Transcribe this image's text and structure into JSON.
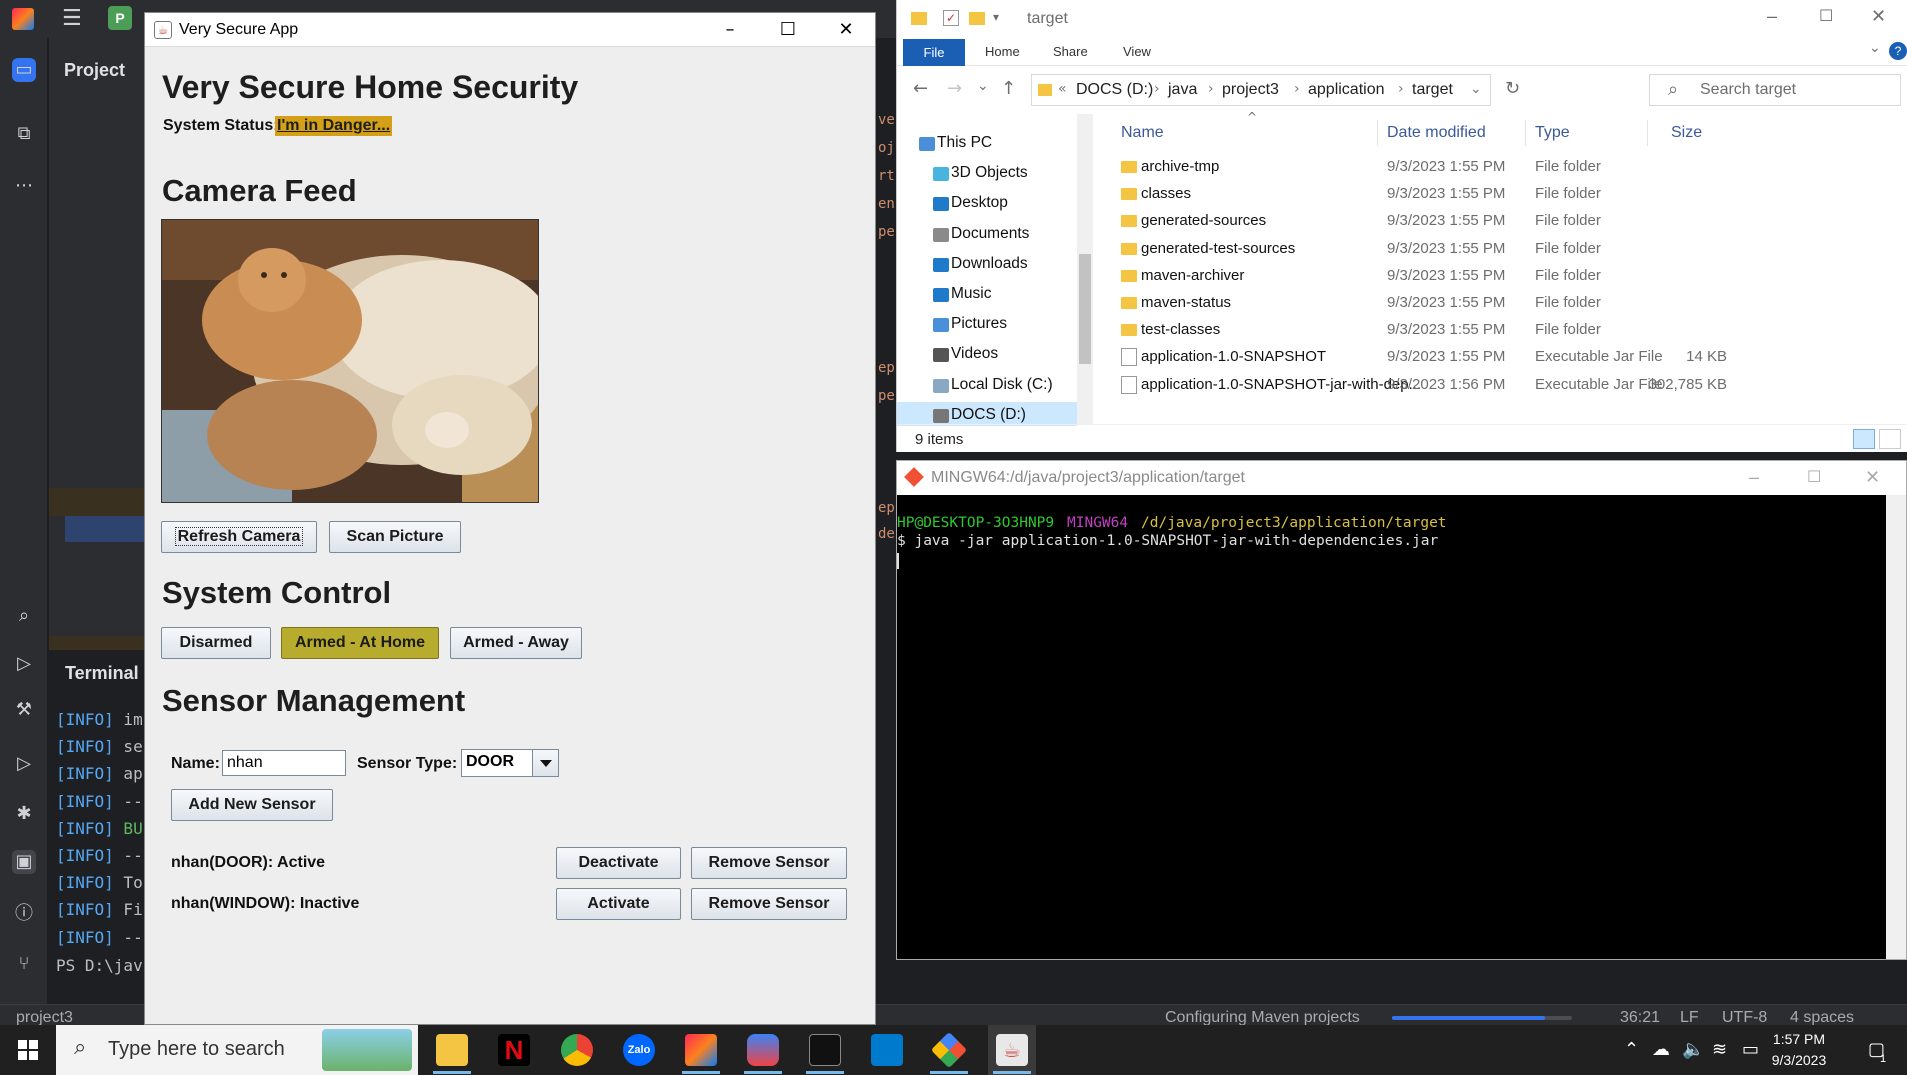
{
  "ide": {
    "project_label": "Project",
    "terminal_label": "Terminal",
    "terminal_lines": [
      {
        "tag": "[INFO]",
        "text": " im"
      },
      {
        "tag": "[INFO]",
        "text": " se"
      },
      {
        "tag": "[INFO]",
        "text": " ap"
      },
      {
        "tag": "[INFO]",
        "text": " --"
      },
      {
        "tag": "[INFO]",
        "text": " BU"
      },
      {
        "tag": "[INFO]",
        "text": " --"
      },
      {
        "tag": "[INFO]",
        "text": " To"
      },
      {
        "tag": "[INFO]",
        "text": " Fi"
      },
      {
        "tag": "[INFO]",
        "text": " --"
      }
    ],
    "prompt": "PS D:\\jav",
    "statusbar": {
      "project": "project3",
      "task": "Configuring Maven projects",
      "task_progress": 0.85,
      "position": "36:21",
      "line_sep": "LF",
      "encoding": "UTF-8",
      "indent": "4 spaces"
    }
  },
  "swing": {
    "title": "Very Secure App",
    "heading": "Very Secure Home Security",
    "status_label": "System Status:",
    "status_value": "I'm in Danger...",
    "camera_heading": "Camera Feed",
    "refresh_btn": "Refresh Camera",
    "scan_btn": "Scan Picture",
    "control_heading": "System Control",
    "mode_buttons": [
      "Disarmed",
      "Armed - At Home",
      "Armed - Away"
    ],
    "active_mode": "Armed - At Home",
    "sensor_heading": "Sensor Management",
    "name_label": "Name:",
    "name_value": "nhan",
    "type_label": "Sensor Type:",
    "type_value": "DOOR",
    "add_btn": "Add New Sensor",
    "sensors": [
      {
        "label": "nhan(DOOR): Active",
        "toggle": "Deactivate",
        "remove": "Remove Sensor"
      },
      {
        "label": "nhan(WINDOW): Inactive",
        "toggle": "Activate",
        "remove": "Remove Sensor"
      }
    ]
  },
  "explorer": {
    "title": "target",
    "tabs": [
      "File",
      "Home",
      "Share",
      "View"
    ],
    "breadcrumb": [
      "DOCS (D:)",
      "java",
      "project3",
      "application",
      "target"
    ],
    "search_placeholder": "Search target",
    "nav": [
      "This PC",
      "3D Objects",
      "Desktop",
      "Documents",
      "Downloads",
      "Music",
      "Pictures",
      "Videos",
      "Local Disk (C:)",
      "DOCS (D:)"
    ],
    "columns": [
      "Name",
      "Date modified",
      "Type",
      "Size"
    ],
    "files": [
      {
        "name": "archive-tmp",
        "date": "9/3/2023 1:55 PM",
        "type": "File folder",
        "size": "",
        "kind": "folder"
      },
      {
        "name": "classes",
        "date": "9/3/2023 1:55 PM",
        "type": "File folder",
        "size": "",
        "kind": "folder"
      },
      {
        "name": "generated-sources",
        "date": "9/3/2023 1:55 PM",
        "type": "File folder",
        "size": "",
        "kind": "folder"
      },
      {
        "name": "generated-test-sources",
        "date": "9/3/2023 1:55 PM",
        "type": "File folder",
        "size": "",
        "kind": "folder"
      },
      {
        "name": "maven-archiver",
        "date": "9/3/2023 1:55 PM",
        "type": "File folder",
        "size": "",
        "kind": "folder"
      },
      {
        "name": "maven-status",
        "date": "9/3/2023 1:55 PM",
        "type": "File folder",
        "size": "",
        "kind": "folder"
      },
      {
        "name": "test-classes",
        "date": "9/3/2023 1:55 PM",
        "type": "File folder",
        "size": "",
        "kind": "folder"
      },
      {
        "name": "application-1.0-SNAPSHOT",
        "date": "9/3/2023 1:55 PM",
        "type": "Executable Jar File",
        "size": "14 KB",
        "kind": "jar"
      },
      {
        "name": "application-1.0-SNAPSHOT-jar-with-dep...",
        "date": "9/3/2023 1:56 PM",
        "type": "Executable Jar File",
        "size": "302,785 KB",
        "kind": "jar"
      }
    ],
    "item_count": "9 items"
  },
  "mingw": {
    "title": "MINGW64:/d/java/project3/application/target",
    "user_host": "HP@DESKTOP-3O3HNP9",
    "shell": "MINGW64",
    "path": "/d/java/project3/application/target",
    "command": "$ java -jar application-1.0-SNAPSHOT-jar-with-dependencies.jar"
  },
  "taskbar": {
    "search_placeholder": "Type here to search",
    "time": "1:57 PM",
    "date": "9/3/2023",
    "notif_count": "1"
  }
}
